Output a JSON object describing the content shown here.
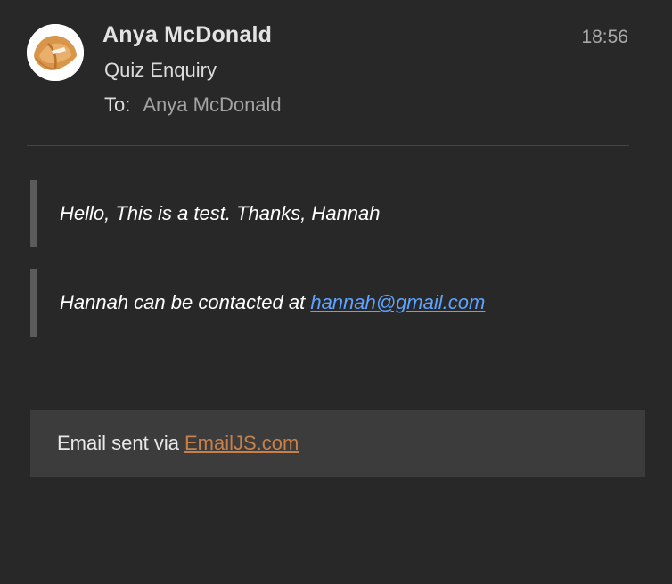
{
  "header": {
    "avatar_icon": "fortune-cookie-icon",
    "sender_name": "Anya McDonald",
    "time": "18:56",
    "subject": "Quiz Enquiry",
    "to_label": "To:",
    "to_value": "Anya McDonald"
  },
  "body": {
    "quote_1": "Hello, This is a test. Thanks, Hannah",
    "quote_2_prefix": "Hannah can be contacted at ",
    "quote_2_link": "hannah@gmail.com"
  },
  "footer": {
    "prefix": "Email sent via",
    "link": "EmailJS.com"
  },
  "colors": {
    "background": "#282828",
    "link_blue": "#5ea3ff",
    "link_orange": "#c7804a",
    "footer_bg": "#3c3c3c"
  }
}
